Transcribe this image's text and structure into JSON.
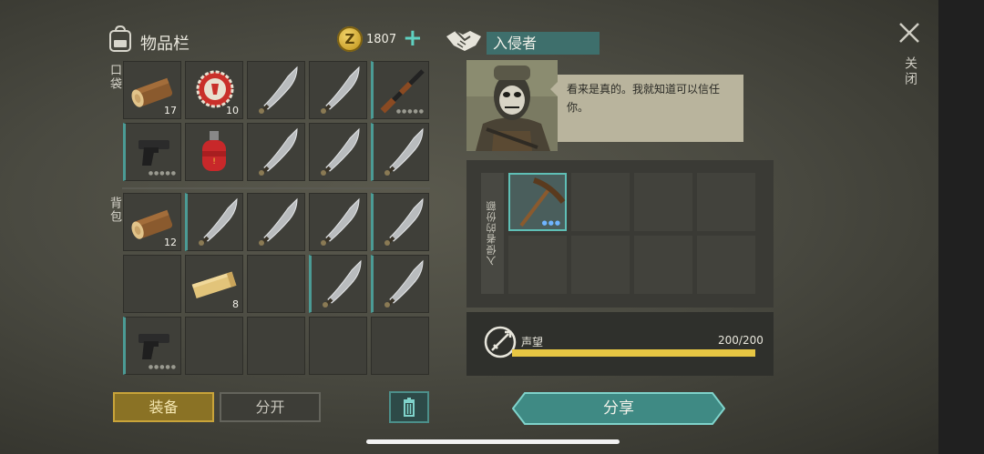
{
  "inventory": {
    "title": "物品栏",
    "coin_symbol": "Z",
    "coins": "1807",
    "plus": "+",
    "pocket_label": "口袋",
    "backpack_label": "背包"
  },
  "pocket_slots": [
    {
      "item": "log",
      "count": "17"
    },
    {
      "item": "bottle-cap",
      "count": "10"
    },
    {
      "item": "machete",
      "count": ""
    },
    {
      "item": "machete",
      "count": ""
    },
    {
      "item": "shotgun",
      "count": "",
      "equipped": true
    },
    {
      "item": "pistol",
      "count": "",
      "equipped": true
    },
    {
      "item": "gas-canister",
      "count": ""
    },
    {
      "item": "machete",
      "count": ""
    },
    {
      "item": "machete",
      "count": ""
    },
    {
      "item": "machete",
      "count": "",
      "equipped": true
    }
  ],
  "backpack_slots": [
    {
      "item": "log",
      "count": "12"
    },
    {
      "item": "machete",
      "count": "",
      "equipped": true
    },
    {
      "item": "machete",
      "count": ""
    },
    {
      "item": "machete",
      "count": ""
    },
    {
      "item": "machete",
      "count": "",
      "equipped": true
    },
    {
      "item": "",
      "count": ""
    },
    {
      "item": "plank",
      "count": "8"
    },
    {
      "item": "",
      "count": ""
    },
    {
      "item": "machete",
      "count": "",
      "equipped": true
    },
    {
      "item": "machete",
      "count": "",
      "equipped": true
    },
    {
      "item": "pistol",
      "count": "",
      "equipped": true
    },
    {
      "item": "",
      "count": ""
    },
    {
      "item": "",
      "count": ""
    },
    {
      "item": "",
      "count": ""
    },
    {
      "item": "",
      "count": ""
    }
  ],
  "buttons": {
    "equip": "装备",
    "split": "分开",
    "share": "分享"
  },
  "intruder": {
    "tab_label": "入侵者",
    "speech": "看来是真的。我就知道可以信任你。",
    "share_label": "入侵者的份额",
    "share_items": [
      "pickaxe",
      "",
      "",
      "",
      "",
      "",
      "",
      ""
    ]
  },
  "reputation": {
    "label": "声望",
    "value": "200/200",
    "fraction": 1.0
  },
  "close": {
    "label": "关闭"
  },
  "colors": {
    "accent_teal": "#3e6f6c",
    "equip_gold": "#c9a43a",
    "rep_bar": "#e7c643"
  }
}
